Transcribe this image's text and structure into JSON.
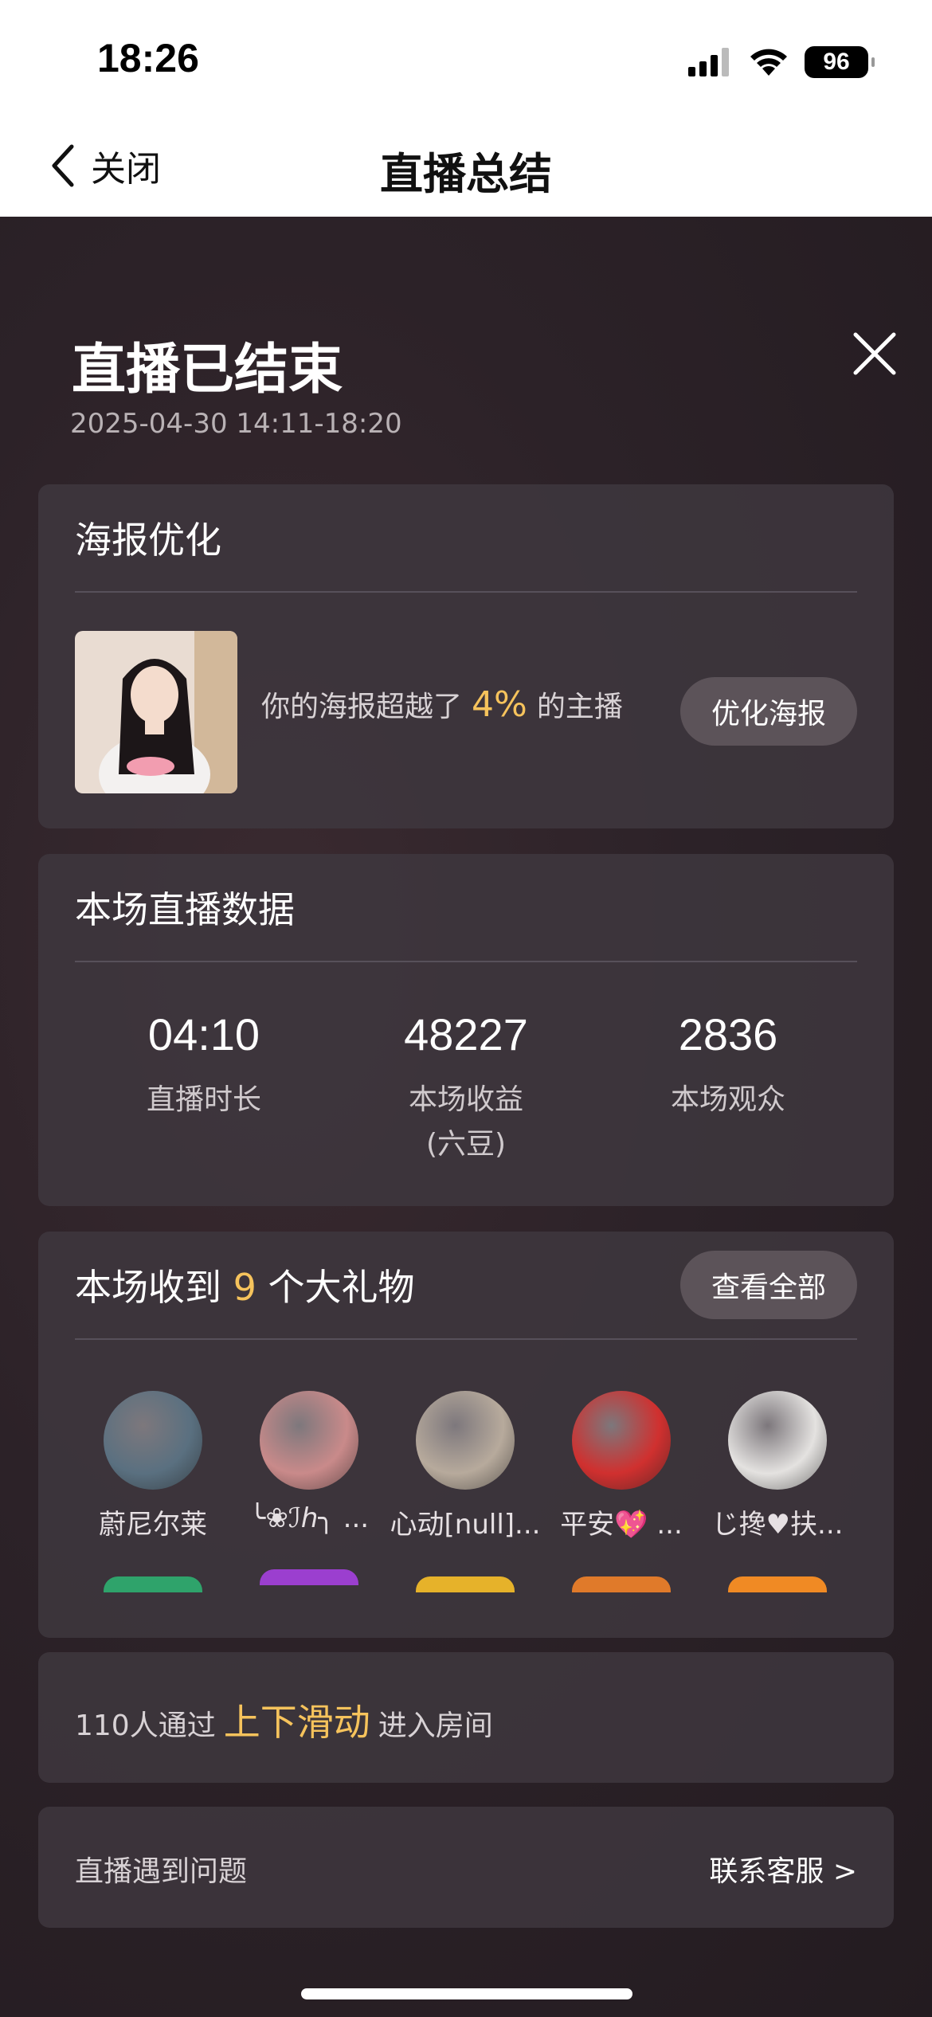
{
  "status_bar": {
    "time": "18:26",
    "battery": "96"
  },
  "nav": {
    "back_label": "关闭",
    "title": "直播总结"
  },
  "summary": {
    "title": "直播已结束",
    "time_range": "2025-04-30 14:11-18:20"
  },
  "poster": {
    "title": "海报优化",
    "text_before": "你的海报超越了",
    "percent": "4%",
    "text_after": "的主播",
    "button": "优化海报"
  },
  "stats": {
    "title": "本场直播数据",
    "items": [
      {
        "value": "04:10",
        "label": "直播时长"
      },
      {
        "value": "48227",
        "label": "本场收益",
        "sub": "(六豆)"
      },
      {
        "value": "2836",
        "label": "本场观众"
      }
    ]
  },
  "gifts": {
    "title_before": "本场收到",
    "count": "9",
    "title_after": "个大礼物",
    "button": "查看全部",
    "givers": [
      {
        "name": "蔚尼尔莱",
        "avatar_color": "#5a7080",
        "badge_color": "#2fa36b"
      },
      {
        "name": "╰❀ℐℎ╮ ...",
        "avatar_color": "#c98a8a",
        "badge_color": "#9b3fcf"
      },
      {
        "name": "心动[null]...",
        "avatar_color": "#b7aa9c",
        "badge_color": "#e6b22a"
      },
      {
        "name": "平安💖 ...",
        "avatar_color": "#d0302f",
        "badge_color": "#e07a2a"
      },
      {
        "name": "じ搀♥扶...",
        "avatar_color": "#e4e2e0",
        "badge_color": "#f08a24"
      }
    ]
  },
  "slide": {
    "text_before": "110人通过",
    "highlight": "上下滑动",
    "text_after": "进入房间"
  },
  "help": {
    "left": "直播遇到问题",
    "right": "联系客服 >"
  }
}
